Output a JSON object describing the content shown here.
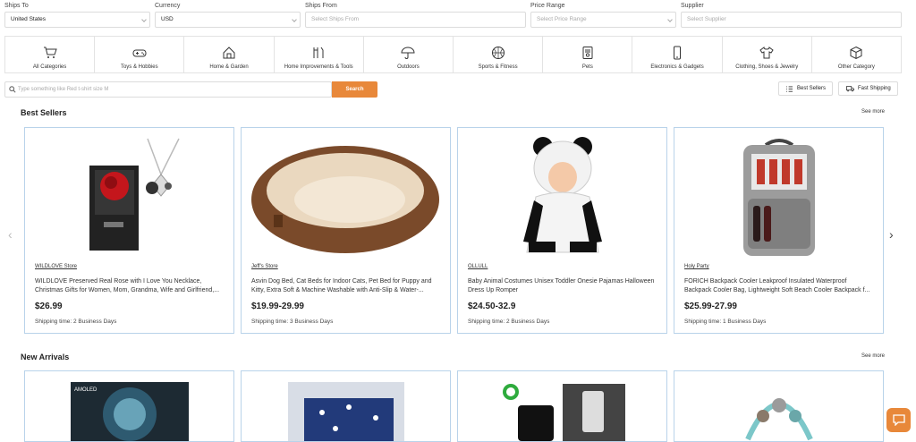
{
  "filters": {
    "ships_to": {
      "label": "Ships To",
      "value": "United States"
    },
    "currency": {
      "label": "Currency",
      "value": "USD"
    },
    "ships_from": {
      "label": "Ships From",
      "placeholder": "Select Ships From"
    },
    "price_range": {
      "label": "Price Range",
      "placeholder": "Select Price Range"
    },
    "supplier": {
      "label": "Supplier",
      "placeholder": "Select Supplier"
    }
  },
  "categories": [
    {
      "label": "All Categories",
      "icon": "cart-icon"
    },
    {
      "label": "Toys & Hobbies",
      "icon": "gamepad-icon"
    },
    {
      "label": "Home & Garden",
      "icon": "house-icon"
    },
    {
      "label": "Home Improvements & Tools",
      "icon": "tools-icon"
    },
    {
      "label": "Outdoors",
      "icon": "umbrella-icon"
    },
    {
      "label": "Sports & Fitness",
      "icon": "ball-icon"
    },
    {
      "label": "Pets",
      "icon": "pet-food-icon"
    },
    {
      "label": "Electronics & Gadgets",
      "icon": "phone-icon"
    },
    {
      "label": "Clothing, Shoes & Jewelry",
      "icon": "shirt-icon"
    },
    {
      "label": "Other Category",
      "icon": "box-icon"
    }
  ],
  "search": {
    "placeholder": "Type something like Red t-shirt size M",
    "button": "Search"
  },
  "toggles": {
    "best_sellers": "Best Sellers",
    "fast_shipping": "Fast Shipping"
  },
  "best_sellers": {
    "title": "Best Sellers",
    "see_more": "See more",
    "products": [
      {
        "store": "WILDLOVE Store",
        "title": "WILDLOVE Preserved Real Rose with I Love You Necklace, Christmas Gifts for Women, Mom, Grandma, Wife and Girlfriend,...",
        "price": "$26.99",
        "shipping": "Shipping time: 2 Business Days"
      },
      {
        "store": "Jeff's Store",
        "title": "Asvin Dog Bed, Cat Beds for Indoor Cats, Pet Bed for Puppy and Kitty, Extra Soft & Machine Washable with Anti-Slip & Water-...",
        "price": "$19.99-29.99",
        "shipping": "Shipping time: 3 Business Days"
      },
      {
        "store": "OLLULL",
        "title": "Baby Animal Costumes Unisex Toddler Onesie Pajamas Halloween Dress Up Romper",
        "price": "$24.50-32.9",
        "shipping": "Shipping time: 2 Business Days"
      },
      {
        "store": "Holy Party",
        "title": "FORICH Backpack Cooler Leakproof Insulated Waterproof Backpack Cooler Bag, Lightweight Soft Beach Cooler Backpack f...",
        "price": "$25.99-27.99",
        "shipping": "Shipping time: 1 Business Days"
      }
    ]
  },
  "new_arrivals": {
    "title": "New Arrivals",
    "see_more": "See more",
    "badge_text": "AMOLED"
  },
  "colors": {
    "accent": "#e8883a",
    "card_border": "#b9d3ea"
  }
}
